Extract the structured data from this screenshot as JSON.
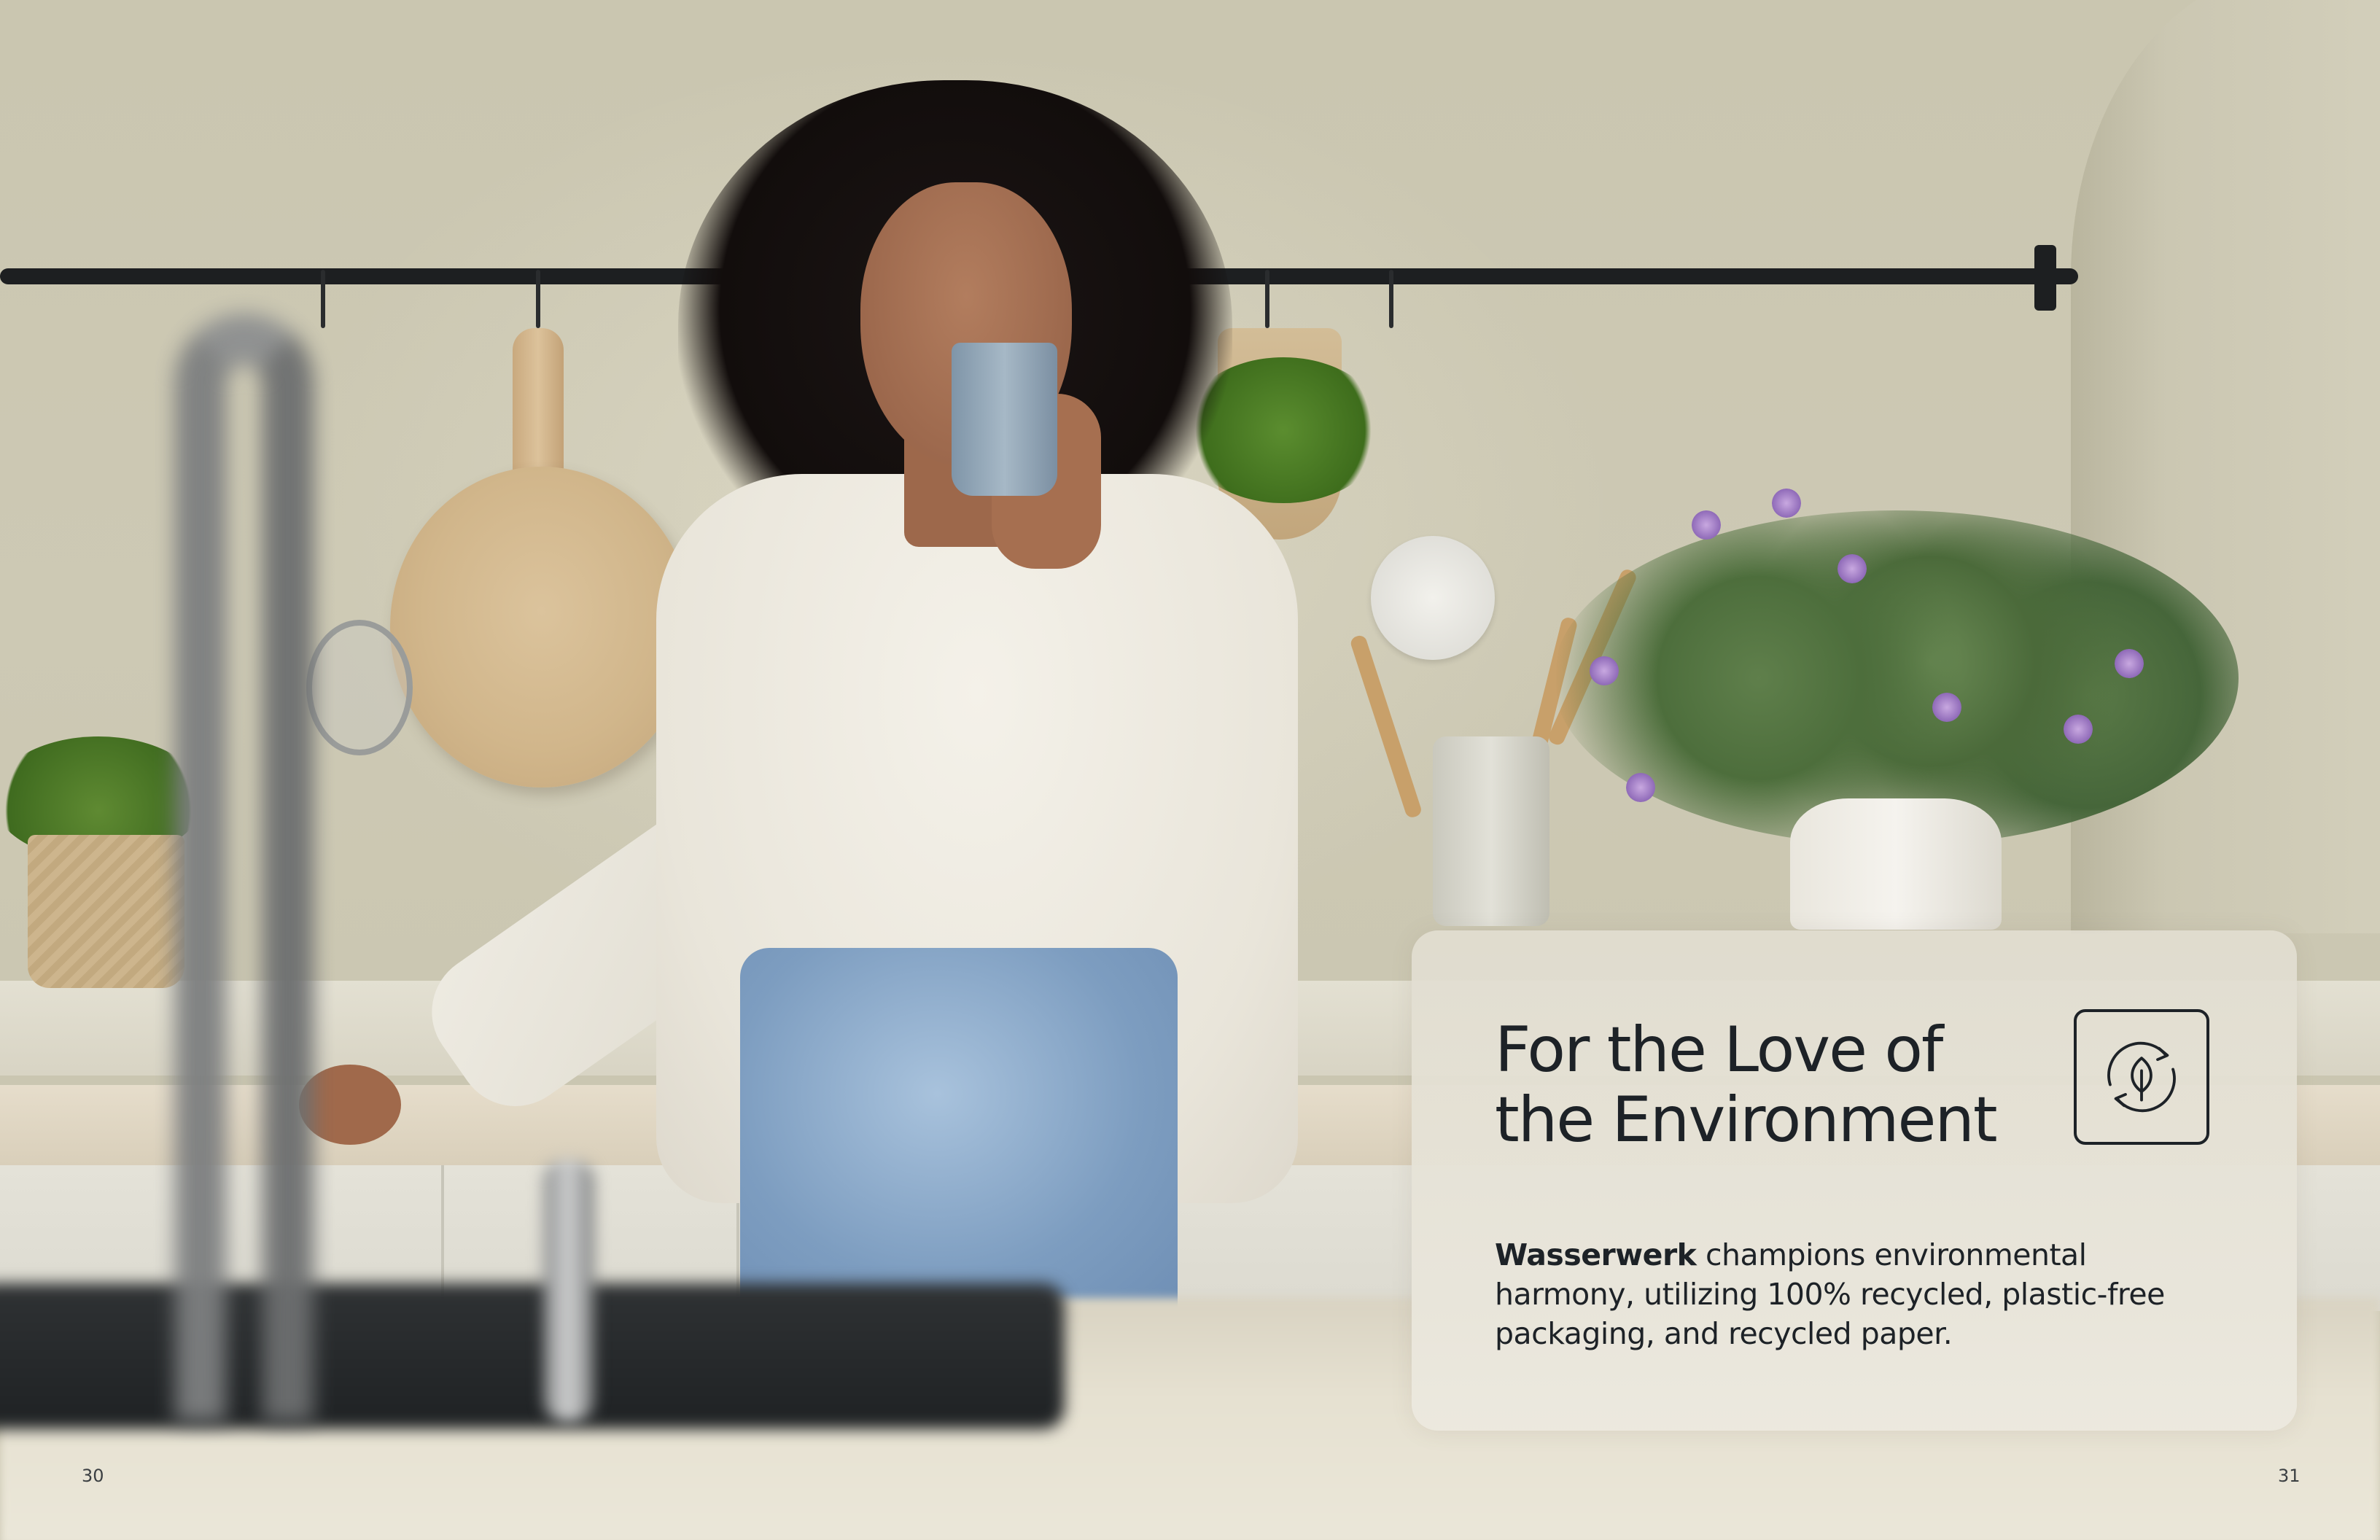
{
  "card": {
    "title": "For the Love of the Environment",
    "body_brand": "Wasserwerk",
    "body_text": " champions environmental harmony, utilizing 100% recycled, plastic-free packaging, and recycled paper.",
    "icon": "recycle-leaf-icon"
  },
  "pages": {
    "left": "30",
    "right": "31"
  },
  "colors": {
    "text": "#1d2227",
    "card_bg": "#e6e2d6",
    "wall": "#cac6b0"
  }
}
